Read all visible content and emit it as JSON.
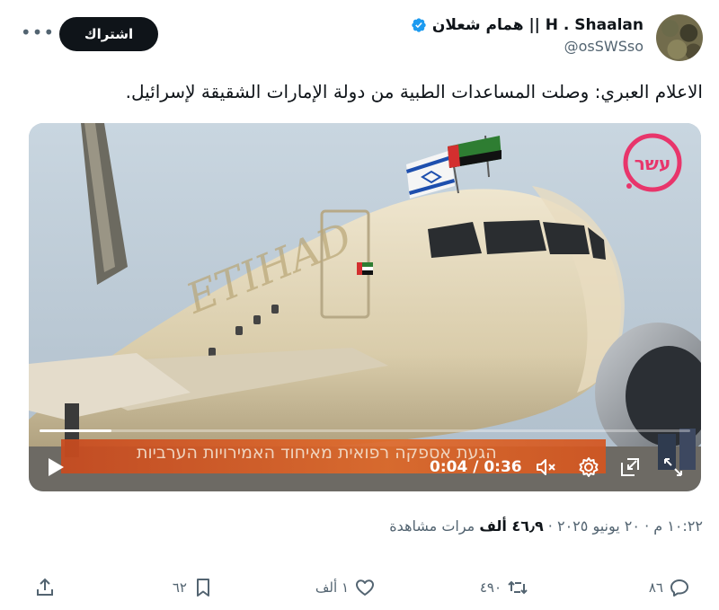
{
  "author": {
    "display_name": "H . Shaalan || همام شعلان",
    "handle": "@osSWSso",
    "verified": true,
    "avatar": "camouflage-avatar"
  },
  "header": {
    "subscribe_label": "اشتراك",
    "more_icon": "more-horizontal-icon"
  },
  "tweet": {
    "text": "الاعلام العبري: وصلت المساعدات الطبية من دولة الإمارات الشقيقة لإسرائيل."
  },
  "video": {
    "channel_logo_text": "עשר",
    "caption": "הגעת אספקה רפואית מאיחוד האמירויות הערביות",
    "time_display": "0:04 / 0:36",
    "progress_fraction": 0.11,
    "controls": [
      "play-icon",
      "mute-icon",
      "settings-icon",
      "picture-in-picture-icon",
      "fullscreen-icon"
    ]
  },
  "meta": {
    "timestamp": "١٠:٢٢ م · ٢٠ يونيو ٢٠٢٥ · ",
    "views_count": "٤٦٫٩ ألف",
    "views_label": " مرات مشاهدة"
  },
  "actions": {
    "replies": "٨٦",
    "reposts": "٤٩٠",
    "likes": "١ ألف",
    "bookmarks": "٦٢"
  },
  "colors": {
    "text": "#0f1419",
    "secondary": "#536471",
    "verified_blue": "#1d9bf0",
    "caption_band": "#d4551f"
  }
}
